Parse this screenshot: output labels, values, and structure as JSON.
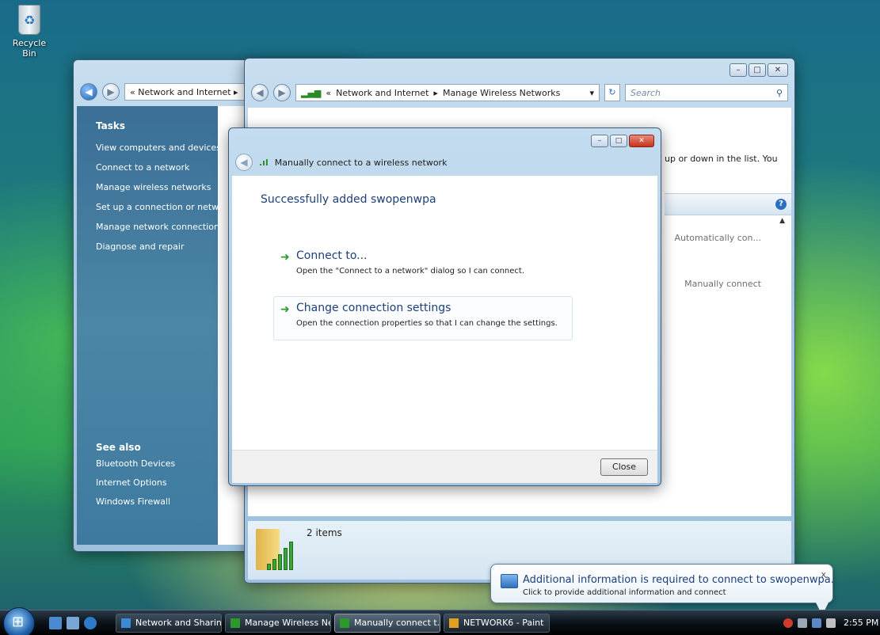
{
  "desktop": {
    "recycle_bin_label": "Recycle Bin"
  },
  "back_window": {
    "breadcrumb": "« Network and Internet ▸",
    "tasks_heading": "Tasks",
    "tasks": [
      "View computers and devices",
      "Connect to a network",
      "Manage wireless networks",
      "Set up a connection or network",
      "Manage network connections",
      "Diagnose and repair"
    ],
    "see_also_heading": "See also",
    "see_also": [
      "Bluetooth Devices",
      "Internet Options",
      "Windows Firewall"
    ]
  },
  "main_window": {
    "breadcrumb_prefix": "«",
    "breadcrumb_parent": "Network and Internet",
    "breadcrumb_sep": "▸",
    "breadcrumb_current": "Manage Wireless Networks",
    "search_placeholder": "Search",
    "obscured_text": "up or down in the list. You",
    "row_labels": [
      "Automatically con...",
      "Manually connect"
    ],
    "details_count": "2 items"
  },
  "dialog": {
    "title": "Manually connect to a wireless network",
    "heading": "Successfully added swopenwpa",
    "commands": [
      {
        "title": "Connect to...",
        "description": "Open the \"Connect to a network\" dialog so I can connect."
      },
      {
        "title": "Change connection settings",
        "description": "Open the connection properties so that I can change the settings."
      }
    ],
    "close_label": "Close"
  },
  "balloon": {
    "title": "Additional information is required to connect to swopenwpa.",
    "subtitle": "Click to provide additional information and connect",
    "close_glyph": "x"
  },
  "taskbar": {
    "buttons": [
      {
        "label": "Network and Sharin...",
        "icon_color": "#3a8ad6"
      },
      {
        "label": "Manage Wireless Ne...",
        "icon_color": "#2a9a2a"
      },
      {
        "label": "Manually connect t...",
        "icon_color": "#2a9a2a"
      },
      {
        "label": "NETWORK6 - Paint",
        "icon_color": "#e0a020"
      }
    ],
    "clock": "2:55 PM"
  },
  "colors": {
    "link_blue": "#1c3f7a",
    "arrow_green": "#2c9a2c",
    "tasks_pane": "#3b6f96"
  }
}
